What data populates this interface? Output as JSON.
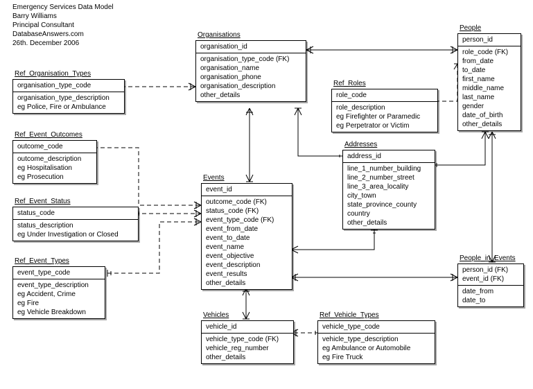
{
  "header": {
    "title": "Emergency Services Data Model",
    "author": "Barry Williams",
    "role": "Principal Consultant",
    "site": "DatabaseAnswers.com",
    "date": "26th. December 2006"
  },
  "entities": {
    "organisations": {
      "title": "Organisations",
      "pk": [
        "organisation_id"
      ],
      "attrs": [
        "organisation_type_code (FK)",
        "organisation_name",
        "organisation_phone",
        "organisation_description",
        "other_details"
      ]
    },
    "people": {
      "title": "People",
      "pk": [
        "person_id"
      ],
      "attrs": [
        "role_code (FK)",
        "from_date",
        "to_date",
        "first_name",
        "middle_name",
        "last_name",
        "gender",
        "date_of_birth",
        "other_details"
      ]
    },
    "ref_org_types": {
      "title": "Ref_Organisation_Types",
      "pk": [
        "organisation_type_code"
      ],
      "attrs": [
        "organisation_type_description",
        "eg Police, Fire or Ambulance"
      ]
    },
    "ref_roles": {
      "title": "Ref_Roles",
      "pk": [
        "role_code"
      ],
      "attrs": [
        "role_description",
        "eg Firefighter or Paramedic",
        "eg Perpetrator or Victim"
      ]
    },
    "ref_event_outcomes": {
      "title": "Ref_Event_Outcomes",
      "pk": [
        "outcome_code"
      ],
      "attrs": [
        "outcome_description",
        "eg Hospitalisation",
        "eg Prosecution"
      ]
    },
    "addresses": {
      "title": "Addresses",
      "pk": [
        "address_id"
      ],
      "attrs": [
        "line_1_number_building",
        "line_2_number_street",
        "line_3_area_locality",
        "city_town",
        "state_province_county",
        "country",
        "other_details"
      ]
    },
    "ref_event_status": {
      "title": "Ref_Event_Status",
      "pk": [
        "status_code"
      ],
      "attrs": [
        "status_description",
        "eg Under Investigation or Closed"
      ]
    },
    "events": {
      "title": "Events",
      "pk": [
        "event_id"
      ],
      "attrs": [
        "outcome_code (FK)",
        "status_code (FK)",
        "event_type_code (FK)",
        "event_from_date",
        "event_to_date",
        "event_name",
        "event_objective",
        "event_description",
        "event_results",
        "other_details"
      ]
    },
    "ref_event_types": {
      "title": "Ref_Event_Types",
      "pk": [
        "event_type_code"
      ],
      "attrs": [
        "event_type_description",
        "eg Accident, Crime",
        "eg Fire",
        "eg Vehicle Breakdown"
      ]
    },
    "people_in_events": {
      "title": "People_in_Events",
      "pk": [
        "person_id (FK)",
        "event_id (FK)"
      ],
      "attrs": [
        "date_from",
        "date_to"
      ]
    },
    "vehicles": {
      "title": "Vehicles",
      "pk": [
        "vehicle_id"
      ],
      "attrs": [
        "vehicle_type_code (FK)",
        "vehicle_reg_number",
        "other_details"
      ]
    },
    "ref_vehicle_types": {
      "title": "Ref_Vehicle_Types",
      "pk": [
        "vehicle_type_code"
      ],
      "attrs": [
        "vehicle_type_description",
        "eg Ambulance or Automobile",
        "eg Fire Truck"
      ]
    }
  },
  "chart_data": {
    "type": "table",
    "title": "Emergency Services Data Model — Entity-Relationship Diagram",
    "entities": [
      "Organisations",
      "People",
      "Ref_Organisation_Types",
      "Ref_Roles",
      "Ref_Event_Outcomes",
      "Addresses",
      "Ref_Event_Status",
      "Events",
      "Ref_Event_Types",
      "People_in_Events",
      "Vehicles",
      "Ref_Vehicle_Types"
    ],
    "relationships": [
      {
        "from": "Ref_Organisation_Types",
        "to": "Organisations",
        "via": "organisation_type_code",
        "style": "dashed"
      },
      {
        "from": "Organisations",
        "to": "People",
        "via": "organisation → person",
        "style": "solid"
      },
      {
        "from": "Ref_Roles",
        "to": "People",
        "via": "role_code",
        "style": "dashed"
      },
      {
        "from": "Ref_Event_Outcomes",
        "to": "Events",
        "via": "outcome_code",
        "style": "dashed"
      },
      {
        "from": "Ref_Event_Status",
        "to": "Events",
        "via": "status_code",
        "style": "dashed"
      },
      {
        "from": "Ref_Event_Types",
        "to": "Events",
        "via": "event_type_code",
        "style": "dashed"
      },
      {
        "from": "Organisations",
        "to": "Events",
        "via": "organisation → event",
        "style": "solid"
      },
      {
        "from": "Addresses",
        "to": "Events",
        "via": "address → event",
        "style": "solid"
      },
      {
        "from": "Addresses",
        "to": "People",
        "via": "address → person",
        "style": "solid"
      },
      {
        "from": "People",
        "to": "People_in_Events",
        "via": "person_id",
        "style": "solid"
      },
      {
        "from": "Events",
        "to": "People_in_Events",
        "via": "event_id",
        "style": "solid"
      },
      {
        "from": "Events",
        "to": "Vehicles",
        "via": "event → vehicle",
        "style": "solid"
      },
      {
        "from": "Ref_Vehicle_Types",
        "to": "Vehicles",
        "via": "vehicle_type_code",
        "style": "dashed"
      }
    ]
  }
}
